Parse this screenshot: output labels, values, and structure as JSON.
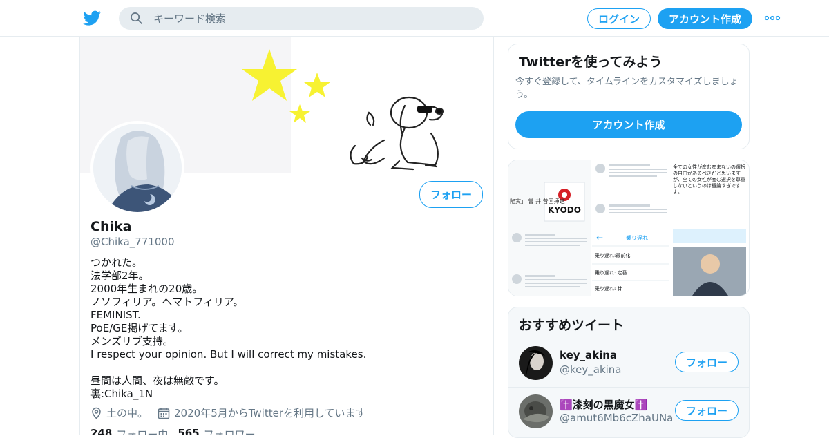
{
  "topbar": {
    "search_placeholder": "キーワード検索",
    "login_label": "ログイン",
    "signup_label": "アカウント作成",
    "more_icon": "more-horizontal-icon",
    "brand_color": "#1da1f2"
  },
  "profile": {
    "follow_label": "フォロー",
    "display_name": "Chika",
    "handle": "@Chika_771000",
    "bio_lines": [
      "つかれた。",
      "法学部2年。",
      "2000年生まれの20歳。",
      "ノソフィリア。ヘマトフィリア。",
      "FEMINIST.",
      "PoE/GE掲げてます。",
      "メンズリブ支持。",
      "I respect your opinion. But I will correct my mistakes.",
      "",
      "昼間は人間、夜は無敵です。",
      "裏:Chika_1N"
    ],
    "location": "土の中。",
    "joined": "2020年5月からTwitterを利用しています",
    "following_count": "248",
    "following_label": "フォロー中",
    "followers_count": "565",
    "followers_label": "フォロワー"
  },
  "try_card": {
    "title": "Twitterを使ってみよう",
    "description": "今すぐ登録して、タイムラインをカスタマイズしましょう。",
    "button_label": "アカウント作成"
  },
  "media": {
    "kyodo_label": "KYODO",
    "fragment_left": "陥実」 曽\n井 昔回挿進",
    "menu_item_1": "乗り遅れ:最前化",
    "menu_item_2": "乗り遅れ: 定番",
    "menu_item_3": "乗り遅れ: 廿",
    "tweet_text": "全ての女性が産む産まないの選択の自由があるべきだと思いますが、全ての女性が産む選択を尊重しないというのは極論すぎですよ。"
  },
  "recommend": {
    "title": "おすすめツイート",
    "follow_label": "フォロー",
    "items": [
      {
        "name": "key_akina",
        "handle": "@key_akina"
      },
      {
        "name": "✝️漆刻の黒魔女✝️",
        "handle": "@amut6Mb6cZhaUNa"
      }
    ]
  }
}
